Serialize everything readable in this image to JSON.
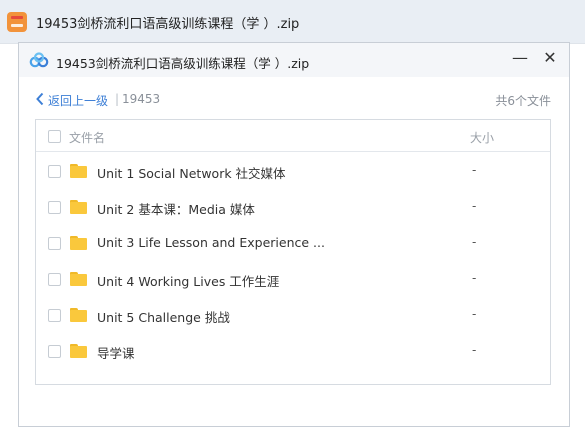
{
  "app": {
    "title": "19453剑桥流利口语高级训练课程（学   ）.zip"
  },
  "dialog": {
    "title": "19453剑桥流利口语高级训练课程（学   ）.zip",
    "minimize_label": "—",
    "close_label": "✕",
    "back_label": "返回上一级",
    "separator": "|",
    "current_folder": "19453",
    "file_count": "共6个文件"
  },
  "list": {
    "columns": {
      "name": "文件名",
      "size": "大小"
    },
    "rows": [
      {
        "name": "Unit 1 Social Network 社交媒体",
        "size": "-"
      },
      {
        "name": "Unit 2 基本课：Media 媒体",
        "size": "-"
      },
      {
        "name": "Unit 3 Life Lesson and Experience ...",
        "size": "-"
      },
      {
        "name": "Unit 4 Working Lives 工作生涯",
        "size": "-"
      },
      {
        "name": "Unit 5 Challenge 挑战",
        "size": "-"
      },
      {
        "name": "导学课",
        "size": "-"
      }
    ]
  },
  "icons": {
    "app": "archive-icon",
    "dialog": "baidu-cloud-logo-icon",
    "row": "folder-icon"
  },
  "colors": {
    "link": "#3d7fd6",
    "folder": "#fac83c",
    "app_bar": "#e9eef4"
  }
}
